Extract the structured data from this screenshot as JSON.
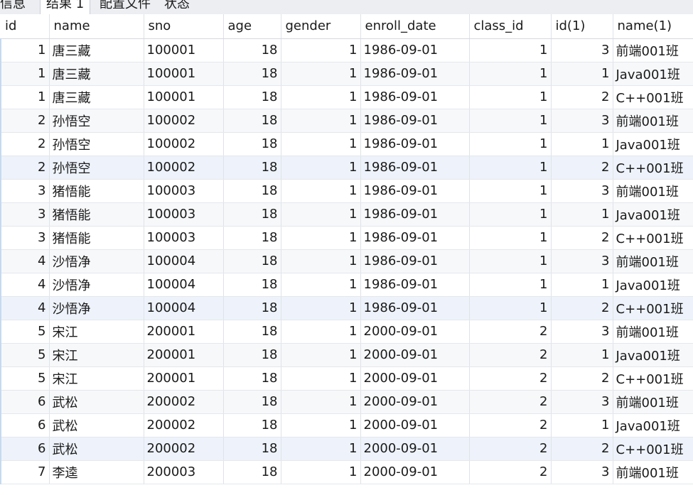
{
  "tabs": [
    {
      "label": "信息",
      "active": false
    },
    {
      "label": "结果 1",
      "active": true
    },
    {
      "label": "配置文件",
      "active": false
    },
    {
      "label": "状态",
      "active": false
    }
  ],
  "table": {
    "columns": [
      "id",
      "name",
      "sno",
      "age",
      "gender",
      "enroll_date",
      "class_id",
      "id(1)",
      "name(1)"
    ],
    "rows": [
      [
        "1",
        "唐三藏",
        "100001",
        "18",
        "1",
        "1986-09-01",
        "1",
        "3",
        "前端001班"
      ],
      [
        "1",
        "唐三藏",
        "100001",
        "18",
        "1",
        "1986-09-01",
        "1",
        "1",
        "Java001班"
      ],
      [
        "1",
        "唐三藏",
        "100001",
        "18",
        "1",
        "1986-09-01",
        "1",
        "2",
        "C++001班"
      ],
      [
        "2",
        "孙悟空",
        "100002",
        "18",
        "1",
        "1986-09-01",
        "1",
        "3",
        "前端001班"
      ],
      [
        "2",
        "孙悟空",
        "100002",
        "18",
        "1",
        "1986-09-01",
        "1",
        "1",
        "Java001班"
      ],
      [
        "2",
        "孙悟空",
        "100002",
        "18",
        "1",
        "1986-09-01",
        "1",
        "2",
        "C++001班"
      ],
      [
        "3",
        "猪悟能",
        "100003",
        "18",
        "1",
        "1986-09-01",
        "1",
        "3",
        "前端001班"
      ],
      [
        "3",
        "猪悟能",
        "100003",
        "18",
        "1",
        "1986-09-01",
        "1",
        "1",
        "Java001班"
      ],
      [
        "3",
        "猪悟能",
        "100003",
        "18",
        "1",
        "1986-09-01",
        "1",
        "2",
        "C++001班"
      ],
      [
        "4",
        "沙悟净",
        "100004",
        "18",
        "1",
        "1986-09-01",
        "1",
        "3",
        "前端001班"
      ],
      [
        "4",
        "沙悟净",
        "100004",
        "18",
        "1",
        "1986-09-01",
        "1",
        "1",
        "Java001班"
      ],
      [
        "4",
        "沙悟净",
        "100004",
        "18",
        "1",
        "1986-09-01",
        "1",
        "2",
        "C++001班"
      ],
      [
        "5",
        "宋江",
        "200001",
        "18",
        "1",
        "2000-09-01",
        "2",
        "3",
        "前端001班"
      ],
      [
        "5",
        "宋江",
        "200001",
        "18",
        "1",
        "2000-09-01",
        "2",
        "1",
        "Java001班"
      ],
      [
        "5",
        "宋江",
        "200001",
        "18",
        "1",
        "2000-09-01",
        "2",
        "2",
        "C++001班"
      ],
      [
        "6",
        "武松",
        "200002",
        "18",
        "1",
        "2000-09-01",
        "2",
        "3",
        "前端001班"
      ],
      [
        "6",
        "武松",
        "200002",
        "18",
        "1",
        "2000-09-01",
        "2",
        "1",
        "Java001班"
      ],
      [
        "6",
        "武松",
        "200002",
        "18",
        "1",
        "2000-09-01",
        "2",
        "2",
        "C++001班"
      ],
      [
        "7",
        "李逵",
        "200003",
        "18",
        "1",
        "2000-09-01",
        "2",
        "3",
        "前端001班"
      ]
    ],
    "numeric_columns": [
      0,
      3,
      4,
      6,
      7
    ]
  }
}
